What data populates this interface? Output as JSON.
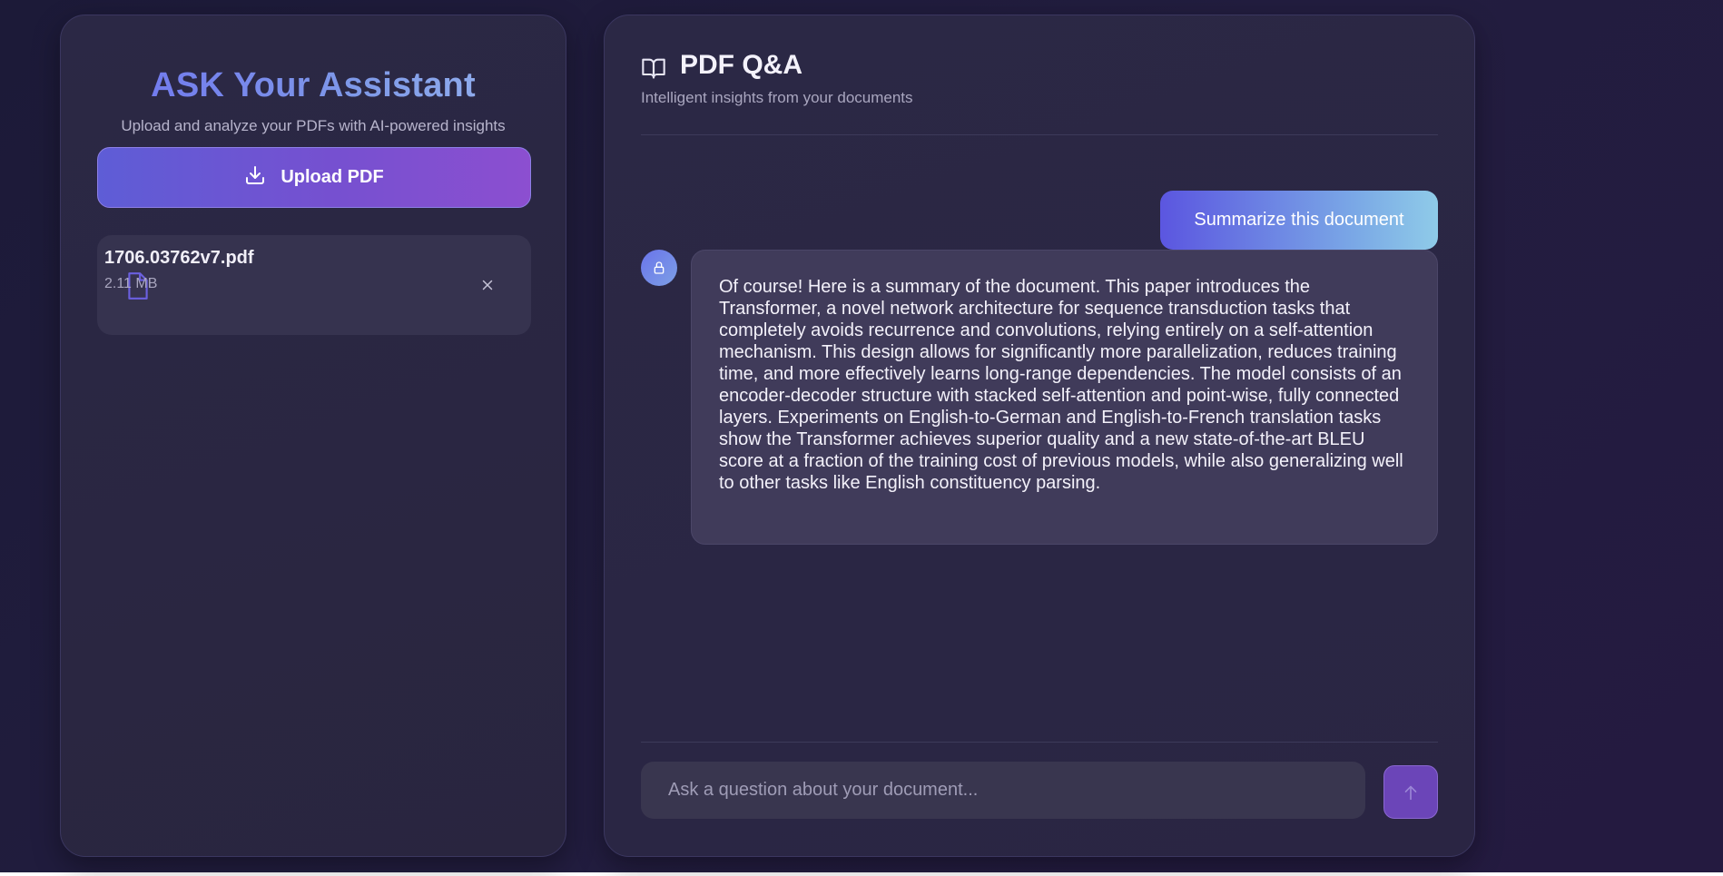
{
  "sidebar": {
    "title": "ASK Your Assistant",
    "subtitle": "Upload and analyze your PDFs with AI-powered insights",
    "upload_label": "Upload PDF",
    "file": {
      "name": "1706.03762v7.pdf",
      "size": "2.11 MB"
    }
  },
  "main": {
    "title": "PDF Q&A",
    "subtitle": "Intelligent insights from your documents",
    "messages": [
      {
        "role": "user",
        "text": "Summarize this document"
      },
      {
        "role": "assistant",
        "text": "Of course! Here is a summary of the document. This paper introduces the Transformer, a novel network architecture for sequence transduction tasks that completely avoids recurrence and convolutions, relying entirely on a self-attention mechanism. This design allows for significantly more parallelization, reduces training time, and more effectively learns long-range dependencies. The model consists of an encoder-decoder structure with stacked self-attention and point-wise, fully connected layers. Experiments on English-to-German and English-to-French translation tasks show the Transformer achieves superior quality and a new state-of-the-art BLEU score at a fraction of the training cost of previous models, while also generalizing well to other tasks like English constituency parsing."
      }
    ],
    "input": {
      "placeholder": "Ask a question about your document...",
      "value": ""
    }
  },
  "icons": {
    "upload": "download-icon",
    "file": "file-icon",
    "remove": "close-icon",
    "header": "book-open-icon",
    "avatar": "lock-icon",
    "send": "arrow-up-icon"
  },
  "colors": {
    "accent": "#6b45b8",
    "title_gradient_start": "#6d6ff0",
    "title_gradient_end": "#9ab7f0",
    "user_bubble_start": "#5b56e0",
    "user_bubble_end": "#8fcbe8"
  }
}
